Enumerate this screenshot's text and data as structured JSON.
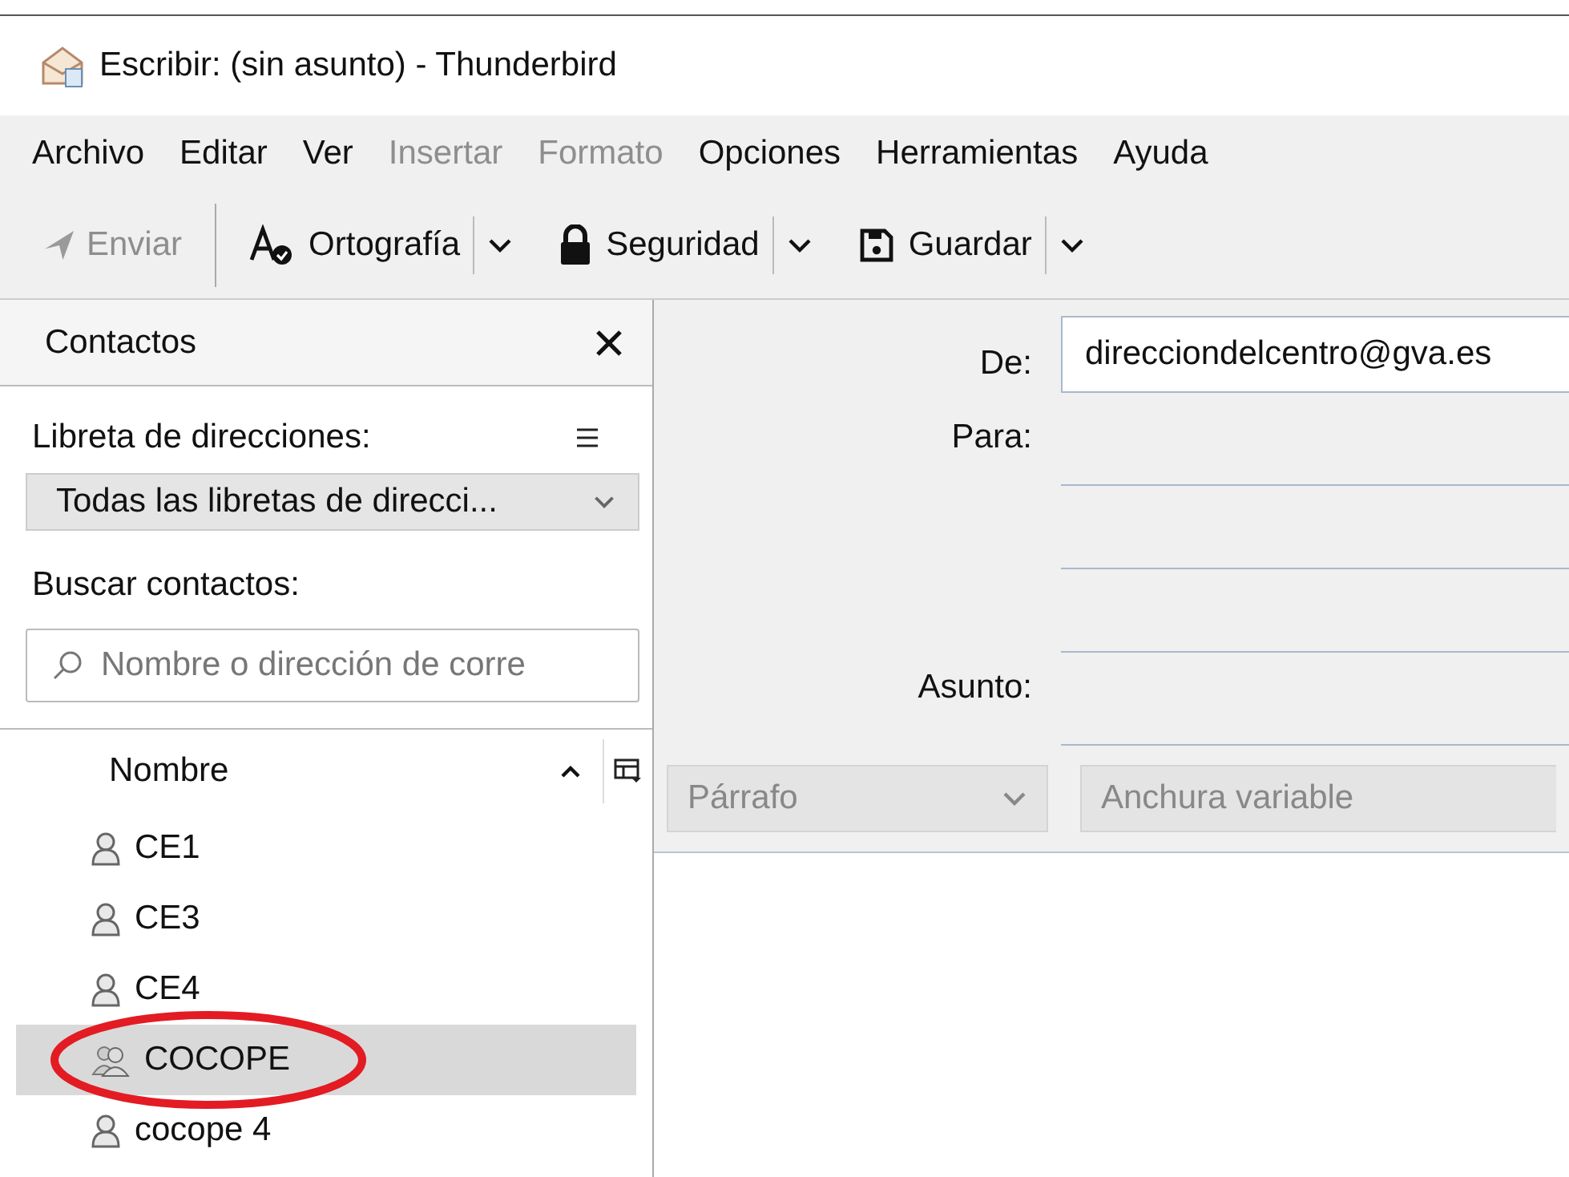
{
  "window": {
    "title": "Escribir: (sin asunto) - Thunderbird"
  },
  "menu": [
    {
      "label": "Archivo",
      "disabled": false
    },
    {
      "label": "Editar",
      "disabled": false
    },
    {
      "label": "Ver",
      "disabled": false
    },
    {
      "label": "Insertar",
      "disabled": true
    },
    {
      "label": "Formato",
      "disabled": true
    },
    {
      "label": "Opciones",
      "disabled": false
    },
    {
      "label": "Herramientas",
      "disabled": false
    },
    {
      "label": "Ayuda",
      "disabled": false
    }
  ],
  "toolbar": [
    {
      "kind": "send",
      "label": "Enviar",
      "disabled": true,
      "dropdown": false
    },
    {
      "kind": "spelling",
      "label": "Ortografía",
      "disabled": false,
      "dropdown": true
    },
    {
      "kind": "security",
      "label": "Seguridad",
      "disabled": false,
      "dropdown": true
    },
    {
      "kind": "save",
      "label": "Guardar",
      "disabled": false,
      "dropdown": true
    }
  ],
  "sidebar": {
    "title": "Contactos",
    "addressbook_label": "Libreta de direcciones:",
    "addressbook_value": "Todas las libretas de direcci...",
    "search_label": "Buscar contactos:",
    "search": {
      "placeholder": "Nombre o dirección de corre"
    },
    "column": "Nombre",
    "contacts": [
      {
        "name": "CE1",
        "kind": "person",
        "selected": false
      },
      {
        "name": "CE3",
        "kind": "person",
        "selected": false
      },
      {
        "name": "CE4",
        "kind": "person",
        "selected": false
      },
      {
        "name": "COCOPE",
        "kind": "list",
        "selected": true
      },
      {
        "name": "cocope 4",
        "kind": "person",
        "selected": false
      }
    ]
  },
  "compose": {
    "fields": [
      {
        "label": "De:",
        "kind": "from",
        "value": "direcciondelcentro@gva.es"
      },
      {
        "label": "Para:",
        "kind": "to"
      },
      {
        "label": "Asunto:",
        "kind": "subject"
      }
    ],
    "paragraph_format": "Párrafo",
    "font": "Anchura variable"
  }
}
